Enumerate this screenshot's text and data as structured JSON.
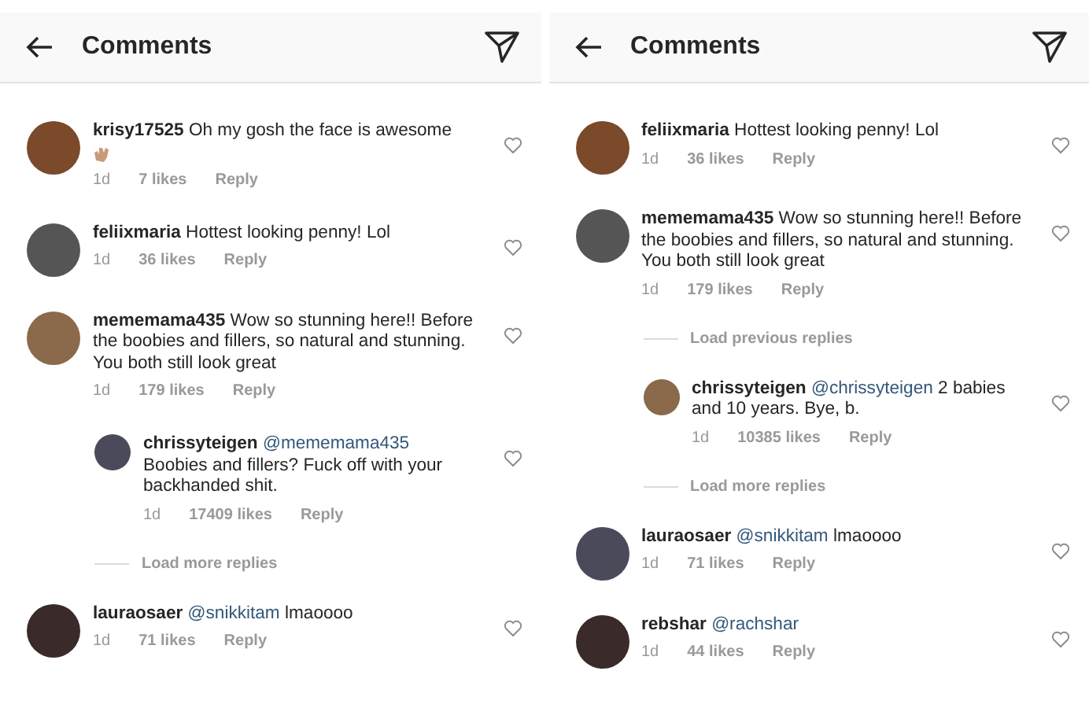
{
  "panels": [
    {
      "header": {
        "title": "Comments"
      },
      "items": [
        {
          "kind": "comment",
          "user": "krisy17525",
          "text": "Oh my gosh the face is awesome",
          "emoji": true,
          "time": "1d",
          "likes": "7 likes",
          "reply": "Reply"
        },
        {
          "kind": "comment",
          "user": "feliixmaria",
          "text": "Hottest looking penny! Lol",
          "time": "1d",
          "likes": "36 likes",
          "reply": "Reply"
        },
        {
          "kind": "comment",
          "user": "mememama435",
          "text": "Wow so stunning here!! Before the boobies and fillers, so natural and stunning. You both still look great",
          "time": "1d",
          "likes": "179 likes",
          "reply": "Reply"
        },
        {
          "kind": "reply",
          "user": "chrissyteigen",
          "mention": "@mememama435",
          "text": "Boobies and fillers? Fuck off with your backhanded shit.",
          "time": "1d",
          "likes": "17409 likes",
          "reply": "Reply"
        },
        {
          "kind": "load",
          "label": "Load more replies"
        },
        {
          "kind": "comment",
          "user": "lauraosaer",
          "mention": "@snikkitam",
          "text": "lmaoooo",
          "time": "1d",
          "likes": "71 likes",
          "reply": "Reply"
        }
      ]
    },
    {
      "header": {
        "title": "Comments"
      },
      "items": [
        {
          "kind": "comment",
          "user": "feliixmaria",
          "text": "Hottest looking penny! Lol",
          "time": "1d",
          "likes": "36 likes",
          "reply": "Reply"
        },
        {
          "kind": "comment",
          "user": "mememama435",
          "text": "Wow so stunning here!! Before the boobies and fillers, so natural and stunning. You both still look great",
          "time": "1d",
          "likes": "179 likes",
          "reply": "Reply"
        },
        {
          "kind": "load",
          "label": "Load previous replies"
        },
        {
          "kind": "reply",
          "user": "chrissyteigen",
          "mention": "@chrissyteigen",
          "text": "2 babies and 10 years. Bye, b.",
          "time": "1d",
          "likes": "10385 likes",
          "reply": "Reply"
        },
        {
          "kind": "load",
          "label": "Load more replies"
        },
        {
          "kind": "comment",
          "user": "lauraosaer",
          "mention": "@snikkitam",
          "text": "lmaoooo",
          "time": "1d",
          "likes": "71 likes",
          "reply": "Reply"
        },
        {
          "kind": "comment",
          "user": "rebshar",
          "mention": "@rachshar",
          "time": "1d",
          "likes": "44 likes",
          "reply": "Reply"
        }
      ]
    }
  ]
}
